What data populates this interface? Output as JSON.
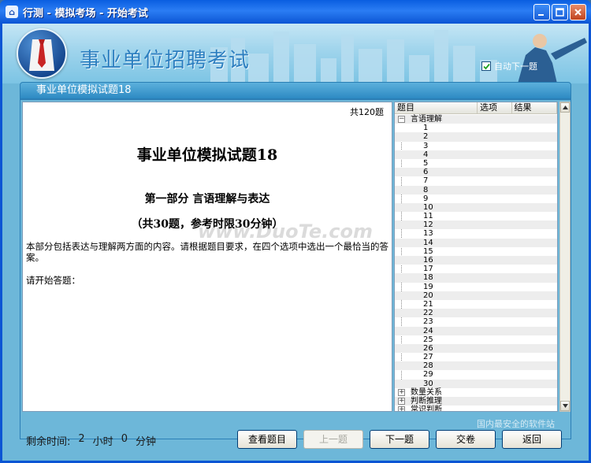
{
  "window": {
    "title": "行测 - 模拟考场 - 开始考试",
    "icon": "building-icon",
    "controls": [
      "minimize-icon",
      "maximize-icon",
      "close-icon"
    ]
  },
  "header": {
    "app_name": "事业单位招聘考试",
    "auto_next_label": "自动下一题",
    "auto_next_checked": true
  },
  "panel": {
    "title": "事业单位模拟试题18"
  },
  "question": {
    "total": "共120题",
    "exam_title": "事业单位模拟试题18",
    "part_title": "第一部分 言语理解与表达",
    "part_sub": "（共30题，参考时限30分钟）",
    "instructions": "本部分包括表达与理解两方面的内容。请根据题目要求，在四个选项中选出一个最恰当的答案。",
    "prompt": "请开始答题：",
    "watermark": "www.DuoTe.com"
  },
  "tree": {
    "columns": [
      "题目",
      "选项",
      "结果"
    ],
    "section1": "言语理解",
    "items": [
      "1",
      "2",
      "3",
      "4",
      "5",
      "6",
      "7",
      "8",
      "9",
      "10",
      "11",
      "12",
      "13",
      "14",
      "15",
      "16",
      "17",
      "18",
      "19",
      "20",
      "21",
      "22",
      "23",
      "24",
      "25",
      "26",
      "27",
      "28",
      "29",
      "30"
    ],
    "section2": "数量关系",
    "section3": "判断推理",
    "section4": "常识判断"
  },
  "footer": {
    "timer_label": "剩余时间:",
    "hours": "2",
    "hours_unit": "小时",
    "minutes": "0",
    "minutes_unit": "分钟",
    "buttons": {
      "view": "查看题目",
      "prev": "上一题",
      "next": "下一题",
      "submit": "交卷",
      "back": "返回"
    },
    "corner_text": "国内最安全的软件站"
  },
  "colors": {
    "titlebar": "#0b55d4",
    "body": "#6db7d9",
    "accent": "#2d7fc0"
  }
}
